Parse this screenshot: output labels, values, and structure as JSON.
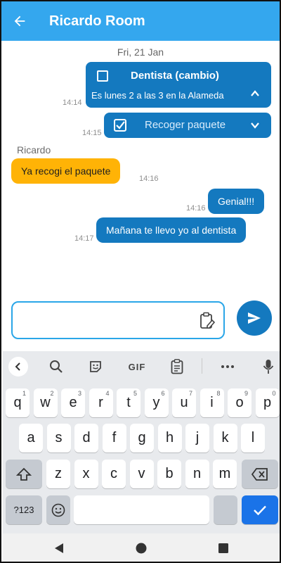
{
  "header": {
    "title": "Ricardo Room",
    "back_icon": "arrow-left-icon"
  },
  "chat": {
    "date": "Fri, 21 Jan",
    "tasks": [
      {
        "title": "Dentista (cambio)",
        "description": "Es lunes 2 a las 3 en la Alameda",
        "time": "14:14",
        "checked": false,
        "expanded": true
      },
      {
        "title": "Recoger paquete",
        "time": "14:15",
        "checked": true,
        "expanded": false
      }
    ],
    "sender": "Ricardo",
    "messages": [
      {
        "text": "Ya recogi el paquete",
        "time": "14:16",
        "incoming": true
      },
      {
        "text": "Genial!!!",
        "time": "14:16",
        "incoming": false
      },
      {
        "text": "Mañana te llevo yo al dentista",
        "time": "14:17",
        "incoming": false
      }
    ]
  },
  "composer": {
    "value": "",
    "placeholder": ""
  },
  "keyboard": {
    "toolbar": {
      "gif_label": "GIF"
    },
    "row1": [
      {
        "k": "q",
        "h": "1"
      },
      {
        "k": "w",
        "h": "2"
      },
      {
        "k": "e",
        "h": "3"
      },
      {
        "k": "r",
        "h": "4"
      },
      {
        "k": "t",
        "h": "5"
      },
      {
        "k": "y",
        "h": "6"
      },
      {
        "k": "u",
        "h": "7"
      },
      {
        "k": "i",
        "h": "8"
      },
      {
        "k": "o",
        "h": "9"
      },
      {
        "k": "p",
        "h": "0"
      }
    ],
    "row2": [
      "a",
      "s",
      "d",
      "f",
      "g",
      "h",
      "j",
      "k",
      "l"
    ],
    "row3": [
      "z",
      "x",
      "c",
      "v",
      "b",
      "n",
      "m"
    ],
    "row4": {
      "symbols": "?123",
      "space": ""
    }
  },
  "colors": {
    "appbar": "#34a7ee",
    "bubble_out": "#1479bf",
    "bubble_in": "#ffb306",
    "accent": "#2aa6e8"
  }
}
